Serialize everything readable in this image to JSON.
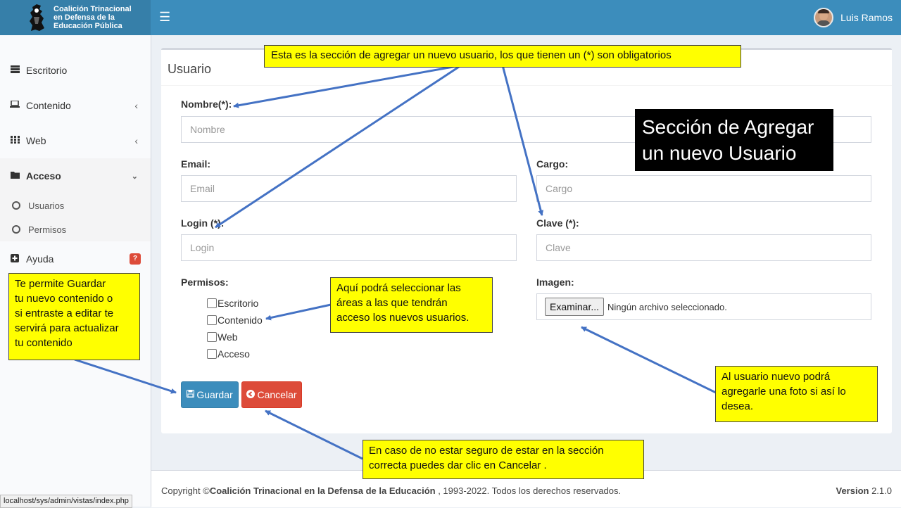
{
  "header": {
    "logo_lines": [
      "Coalición Trinacional",
      "en Defensa de la",
      "Educación Pública"
    ],
    "menu_icon": "hamburger-icon",
    "user_name": "Luis Ramos"
  },
  "sidebar": {
    "items": [
      {
        "label": "Escritorio",
        "icon": "dashboard-icon"
      },
      {
        "label": "Contenido",
        "icon": "laptop-icon"
      },
      {
        "label": "Web",
        "icon": "grid-icon"
      },
      {
        "label": "Acceso",
        "icon": "folder-icon"
      },
      {
        "label": "Ayuda",
        "icon": "plus-square-icon",
        "badge": "?"
      }
    ],
    "sub_items": [
      "Usuarios",
      "Permisos"
    ]
  },
  "form": {
    "title": "Usuario",
    "nombre_label": "Nombre(*):",
    "nombre_placeholder": "Nombre",
    "email_label": "Email:",
    "email_placeholder": "Email",
    "cargo_label": "Cargo:",
    "cargo_placeholder": "Cargo",
    "login_label": "Login (*):",
    "login_placeholder": "Login",
    "clave_label": "Clave (*):",
    "clave_placeholder": "Clave",
    "permisos_label": "Permisos:",
    "permisos": [
      "Escritorio",
      "Contenido",
      "Web",
      "Acceso"
    ],
    "imagen_label": "Imagen:",
    "file_button": "Examinar...",
    "file_status": "Ningún archivo seleccionado.",
    "save_label": "Guardar",
    "cancel_label": "Cancelar"
  },
  "footer": {
    "copyright_prefix": "Copyright ©",
    "copyright_org": "Coalición Trinacional en la Defensa de la Educación",
    "copyright_suffix": " , 1993-2022. Todos los derechos reservados.",
    "version_label": "Version",
    "version_number": "2.1.0"
  },
  "status_url": "localhost/sys/admin/vistas/index.php",
  "annotations": {
    "top": "Esta es la sección de agregar un nuevo usuario, los que tienen  un (*) son obligatorios",
    "section_title": [
      "Sección de Agregar",
      "un nuevo Usuario"
    ],
    "permisos": [
      "Aquí podrá seleccionar las",
      "áreas a las que tendrán",
      "acceso los nuevos usuarios."
    ],
    "guardar": [
      "Te permite Guardar",
      "tu nuevo contenido o",
      "si entraste a editar te",
      "servirá para actualizar",
      "tu contenido"
    ],
    "imagen": [
      "Al usuario nuevo podrá",
      "agregarle una foto si así lo",
      "desea."
    ],
    "cancelar": [
      "En caso de no estar seguro de estar en la sección",
      "correcta puedes dar clic en Cancelar ."
    ]
  },
  "colors": {
    "header": "#3c8dbc",
    "logo_bg": "#367fa9",
    "primary": "#3c8dbc",
    "danger": "#dd4b39",
    "callout": "#ffff00",
    "arrow": "#4472c4"
  }
}
